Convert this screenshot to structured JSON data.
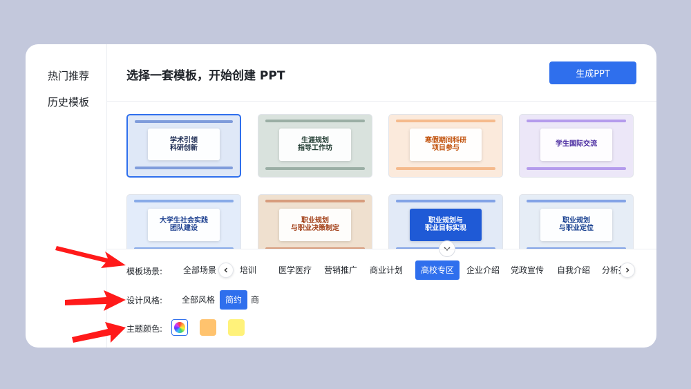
{
  "sidebar": {
    "items": [
      {
        "label": "热门推荐"
      },
      {
        "label": "历史模板"
      }
    ]
  },
  "header": {
    "title": "选择一套模板，开始创建 PPT",
    "generate_label": "生成PPT"
  },
  "templates": [
    {
      "title": "学术引领\n科研创新",
      "colors": {
        "bg": "#dfe8f7",
        "accent": "#1f4fbf",
        "text": "#1b2a52"
      },
      "selected": true
    },
    {
      "title": "生涯规划\n指导工作坊",
      "colors": {
        "bg": "#d9e2dd",
        "accent": "#5b7a6c",
        "text": "#1f3a30"
      },
      "selected": false
    },
    {
      "title": "寒假期间科研\n项目参与",
      "colors": {
        "bg": "#fbeadc",
        "accent": "#f08a3c",
        "text": "#c2540f"
      },
      "selected": false
    },
    {
      "title": "学生国际交流",
      "colors": {
        "bg": "#ece7f8",
        "accent": "#7b4fe0",
        "text": "#4a2ba0"
      },
      "selected": false
    },
    {
      "title": "大学生社会实践\n团队建设",
      "colors": {
        "bg": "#e3ecfa",
        "accent": "#2e67d6",
        "text": "#1c3f8f"
      },
      "selected": false
    },
    {
      "title": "职业规划\n与职业决策制定",
      "colors": {
        "bg": "#efe0cf",
        "accent": "#c0582c",
        "text": "#a23f17"
      },
      "selected": false
    },
    {
      "title": "职业规划与\n职业目标实现",
      "colors": {
        "bg": "#e2eaf7",
        "accent": "#1f5ad6",
        "text": "#ffffff"
      },
      "selected": false
    },
    {
      "title": "职业规划\n与职业定位",
      "colors": {
        "bg": "#e6edf6",
        "accent": "#1f5ad6",
        "text": "#163e8f"
      },
      "selected": false
    }
  ],
  "filters": {
    "scene_label": "模板场景:",
    "scene_options": [
      {
        "label": "全部场景",
        "active": false
      },
      {
        "label": "培训",
        "active": false
      },
      {
        "label": "医学医疗",
        "active": false
      },
      {
        "label": "营销推广",
        "active": false
      },
      {
        "label": "商业计划",
        "active": false
      },
      {
        "label": "高校专区",
        "active": true
      },
      {
        "label": "企业介绍",
        "active": false
      },
      {
        "label": "党政宣传",
        "active": false
      },
      {
        "label": "自我介绍",
        "active": false
      },
      {
        "label": "分析报告",
        "active": false
      }
    ],
    "style_label": "设计风格:",
    "style_options": [
      {
        "label": "全部风格",
        "active": false
      },
      {
        "label": "简约",
        "active": true
      },
      {
        "label": "商",
        "active": false
      }
    ],
    "color_label": "主题颜色:",
    "colors": [
      {
        "name": "all-colors",
        "value": "rainbow",
        "selected": true
      },
      {
        "name": "orange",
        "value": "#ffc36e",
        "selected": false
      },
      {
        "name": "yellow",
        "value": "#fff27a",
        "selected": false
      }
    ]
  },
  "icons": {
    "collapse": "chevron-down-icon",
    "scroll_left": "chevron-left-icon",
    "scroll_right": "chevron-right-icon",
    "annotation": "red-arrow-icon"
  },
  "theme": {
    "accent": "#2f6fed",
    "background": "#c3c8dc",
    "arrow": "#ff1a1a"
  }
}
